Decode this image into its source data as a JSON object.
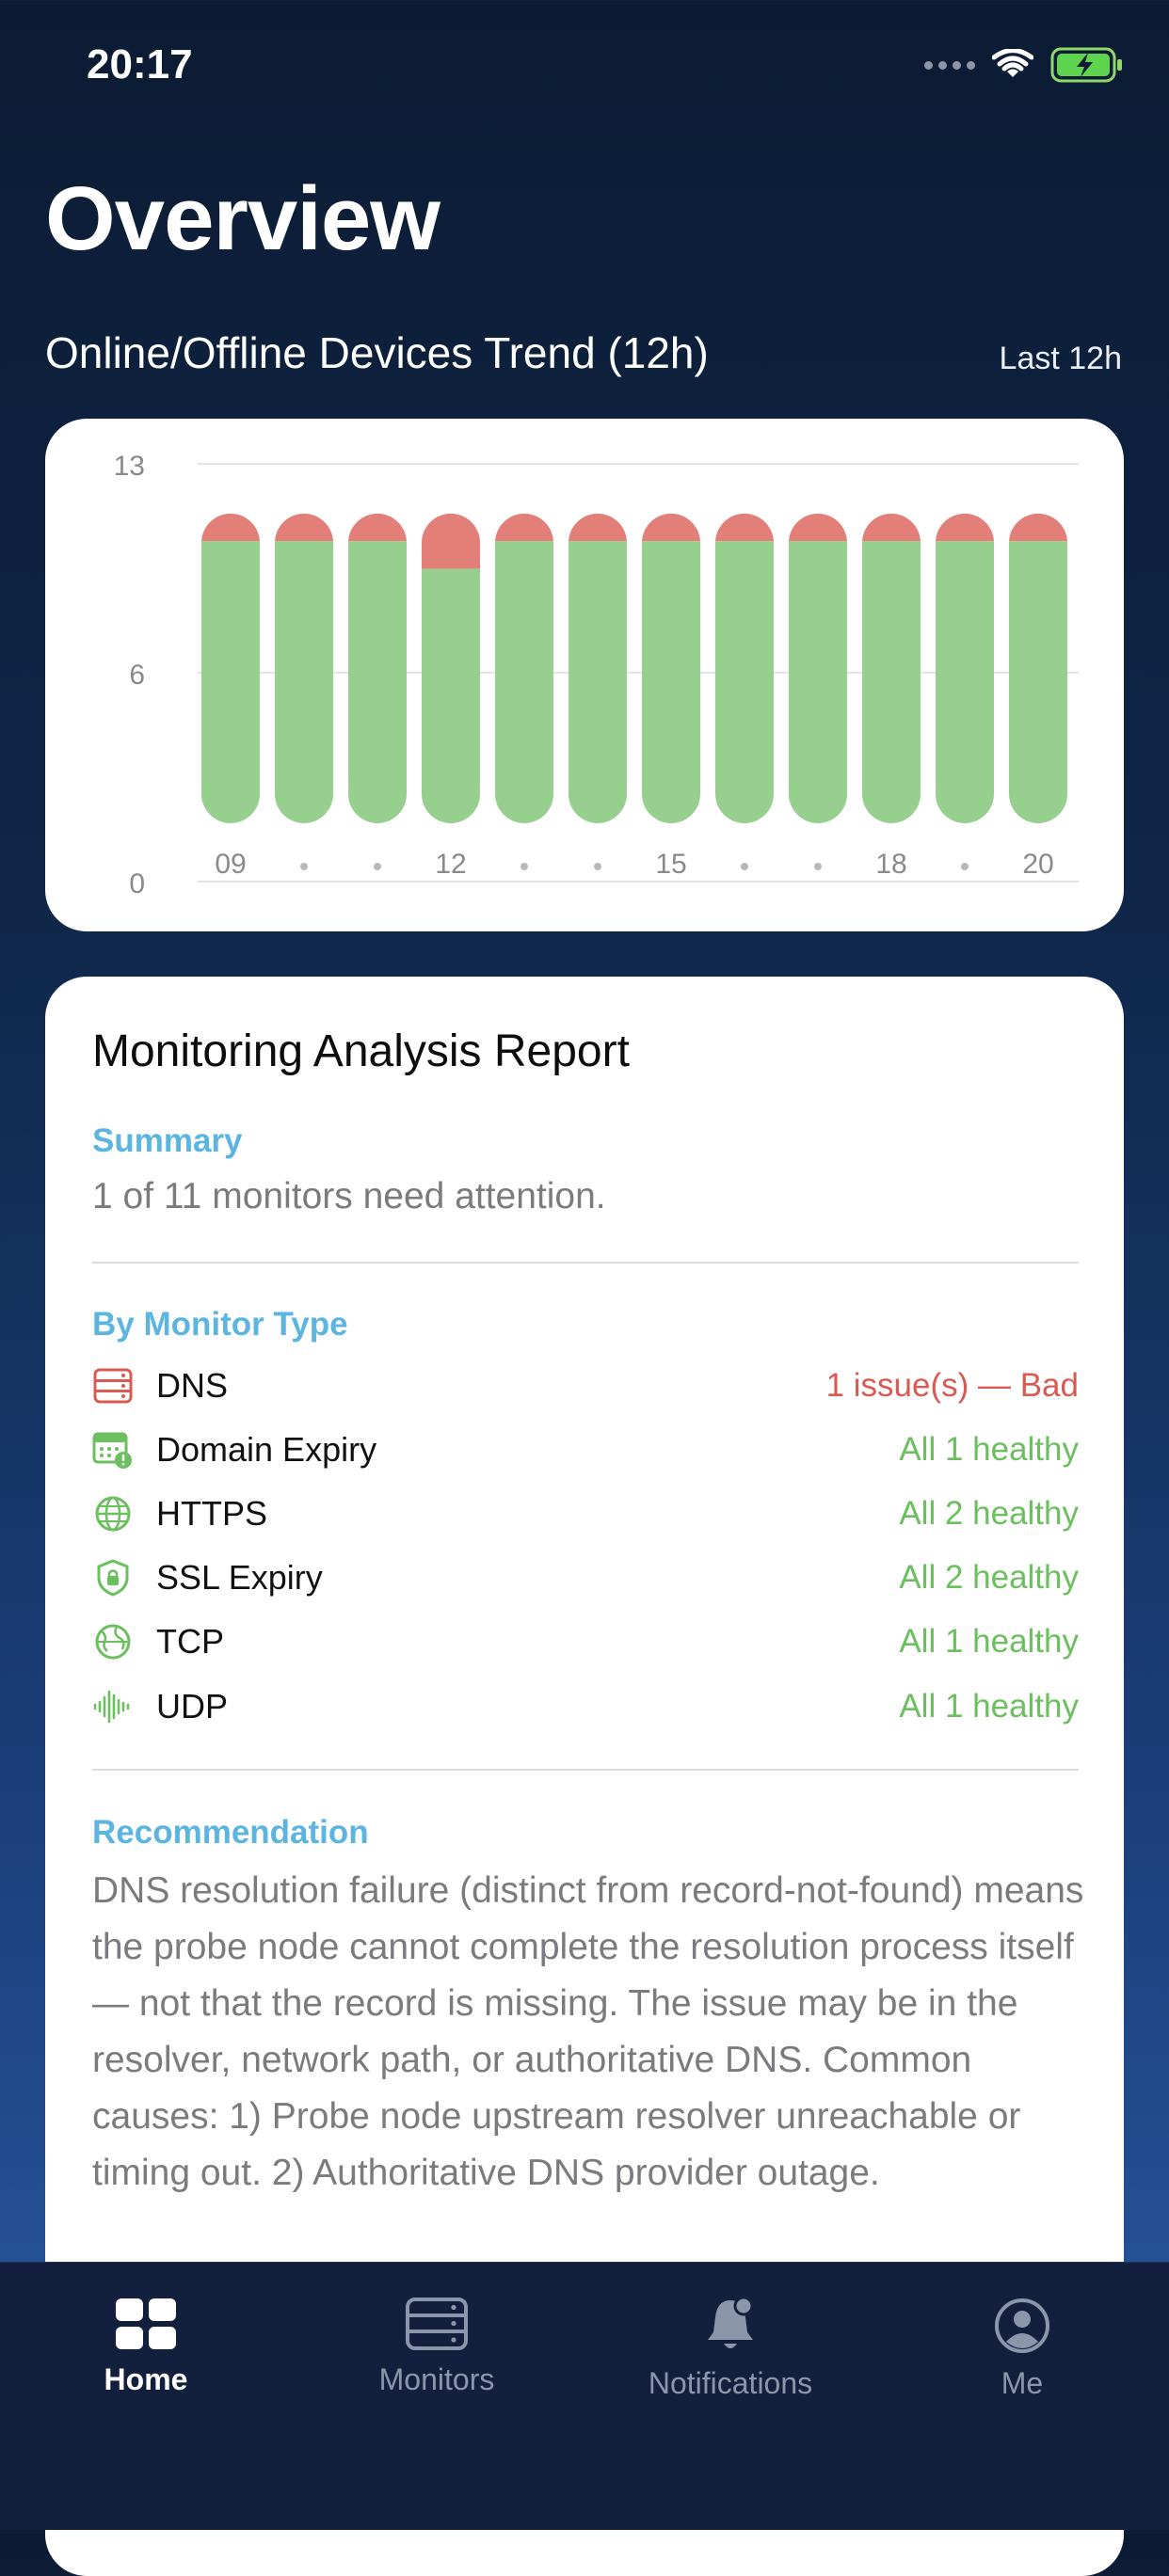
{
  "status_bar": {
    "time": "20:17"
  },
  "page": {
    "title": "Overview",
    "trend_title": "Online/Offline Devices Trend (12h)",
    "trend_range": "Last 12h"
  },
  "chart_data": {
    "type": "bar",
    "stacked": true,
    "categories": [
      "09",
      "·",
      "·",
      "12",
      "·",
      "·",
      "15",
      "·",
      "·",
      "18",
      "·",
      "20"
    ],
    "x_tick_labels": [
      "09",
      "12",
      "15",
      "18",
      "20"
    ],
    "ylim": [
      0,
      13
    ],
    "yticks": [
      "0",
      "6",
      "13"
    ],
    "grid": true,
    "series": [
      {
        "values": [
          10,
          10,
          10,
          9,
          10,
          10,
          10,
          10,
          10,
          10,
          10,
          10
        ],
        "color": "#97cf8f"
      },
      {
        "values": [
          1,
          1,
          1,
          2,
          1,
          1,
          1,
          1,
          1,
          1,
          1,
          1
        ],
        "color": "#e27f79"
      }
    ]
  },
  "report": {
    "title": "Monitoring Analysis Report",
    "summary_heading": "Summary",
    "summary_text": "1 of 11 monitors need attention.",
    "by_type_heading": "By Monitor Type",
    "types": [
      {
        "name": "DNS",
        "status": "1 issue(s) — Bad",
        "icon": "server-icon",
        "color": "#d85a52"
      },
      {
        "name": "Domain Expiry",
        "status": "All 1 healthy",
        "icon": "calendar-alert-icon",
        "color": "#6bbf5e"
      },
      {
        "name": "HTTPS",
        "status": "All 2 healthy",
        "icon": "globe-icon",
        "color": "#6bbf5e"
      },
      {
        "name": "SSL Expiry",
        "status": "All 2 healthy",
        "icon": "shield-lock-icon",
        "color": "#6bbf5e"
      },
      {
        "name": "TCP",
        "status": "All 1 healthy",
        "icon": "network-globe-icon",
        "color": "#6bbf5e"
      },
      {
        "name": "UDP",
        "status": "All 1 healthy",
        "icon": "waveform-icon",
        "color": "#6bbf5e"
      }
    ],
    "recommendation_heading": "Recommendation",
    "recommendation_text": "DNS resolution failure (distinct from record-not-found) means the probe node cannot complete the resolution process itself — not that the record is missing. The issue may be in the resolver, network path, or authoritative DNS. Common causes: 1) Probe node upstream resolver unreachable or timing out. 2) Authoritative DNS provider outage."
  },
  "tabs": [
    {
      "label": "Home",
      "icon": "grid-icon",
      "active": true
    },
    {
      "label": "Monitors",
      "icon": "server-icon",
      "active": false
    },
    {
      "label": "Notifications",
      "icon": "bell-icon",
      "active": false
    },
    {
      "label": "Me",
      "icon": "person-icon",
      "active": false
    }
  ]
}
